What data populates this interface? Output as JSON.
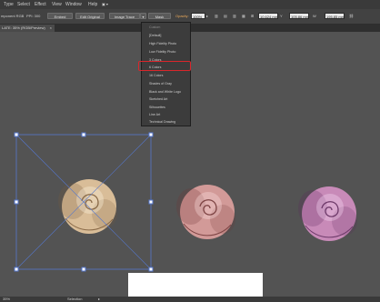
{
  "menu": {
    "items": [
      "Type",
      "Select",
      "Effect",
      "View",
      "Window",
      "Help"
    ]
  },
  "control_bar": {
    "doc_label": "mponent RGB",
    "ppi_label": "PPI: 300",
    "embed": "Embed",
    "edit_original": "Edit Original",
    "image_trace": "Image Trace",
    "mask": "Mask",
    "opacity_label": "Opacity:",
    "opacity_value": "100%",
    "x_value": "10.624 mm",
    "y_value": "105.86 mm",
    "w_value": "195.85 mm"
  },
  "tab": {
    "title": "LATE: 35% (RGB/Preview)",
    "close": "×"
  },
  "trace_presets": {
    "items": [
      "Custom",
      "[Default]",
      "High Fidelity Photo",
      "Low Fidelity Photo",
      "3 Colors",
      "6 Colors",
      "16 Colors",
      "Shades of Gray",
      "Black and White Logo",
      "Sketched Art",
      "Silhouettes",
      "Line Art",
      "Technical Drawing"
    ],
    "highlighted": "6 Colors"
  },
  "status": {
    "zoom": "35%",
    "tool": "Selection"
  },
  "colors": {
    "rose_beige": "#d9bd98",
    "rose_pink": "#d29a98",
    "rose_lilac": "#c88ab8",
    "selection": "#5577cc",
    "highlight": "#d9262b"
  }
}
